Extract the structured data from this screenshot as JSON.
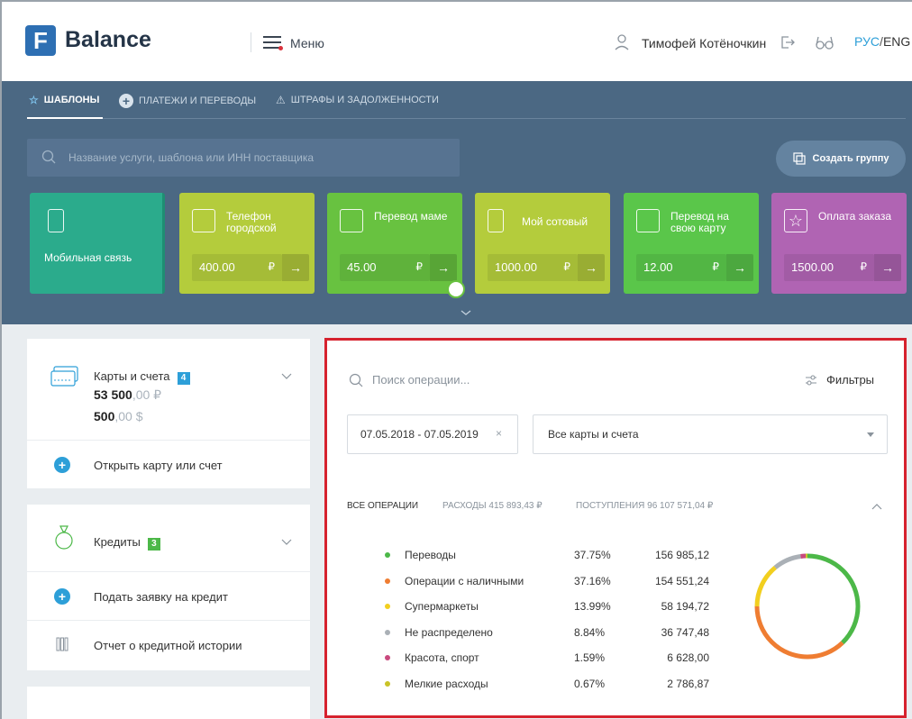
{
  "header": {
    "logo_letter": "F",
    "app_name": "Balance",
    "menu_label": "Меню",
    "user_name": "Тимофей Котёночкин",
    "lang_active": "РУС",
    "lang_sep": "/",
    "lang_other": "ENG"
  },
  "tabs": [
    {
      "label": "ШАБЛОНЫ",
      "active": true,
      "icon": "star-icon"
    },
    {
      "label": "ПЛАТЕЖИ И ПЕРЕВОДЫ",
      "active": false,
      "icon": "plus-circle-icon"
    },
    {
      "label": "ШТРАФЫ И ЗАДОЛЖЕННОСТИ",
      "active": false,
      "icon": "warning-icon"
    }
  ],
  "search": {
    "placeholder": "Название услуги, шаблона или ИНН поставщика"
  },
  "create_group_label": "Создать группу",
  "templates": [
    {
      "name": "Мобильная связь",
      "amount": "",
      "currency": "",
      "color": "#2bab8c",
      "icon": "phone-icon"
    },
    {
      "name": "Телефон городской",
      "amount": "400.00",
      "currency": "₽",
      "color": "#b4cc3c",
      "icon": "landline-icon"
    },
    {
      "name": "Перевод маме",
      "amount": "45.00",
      "currency": "₽",
      "color": "#68c240",
      "icon": "person-icon"
    },
    {
      "name": "Мой сотовый",
      "amount": "1000.00",
      "currency": "₽",
      "color": "#b4cc3c",
      "icon": "phone-icon"
    },
    {
      "name": "Перевод на свою карту",
      "amount": "12.00",
      "currency": "₽",
      "color": "#5ac64a",
      "icon": "person-transfer-icon"
    },
    {
      "name": "Оплата заказа",
      "amount": "1500.00",
      "currency": "₽",
      "color": "#b064b3",
      "icon": "star-icon"
    }
  ],
  "go_arrow": "→",
  "left_panel": {
    "accounts": {
      "title": "Карты и счета",
      "badge": "4",
      "badge_color": "#2d9fd8",
      "rub_whole": "53 500",
      "rub_frac": ",00 ₽",
      "usd_whole": "500",
      "usd_frac": ",00 $",
      "action": "Открыть карту или счет"
    },
    "credits": {
      "title": "Кредиты",
      "badge": "3",
      "badge_color": "#4cb848",
      "action": "Подать заявку на кредит",
      "report": "Отчет о кредитной истории"
    }
  },
  "operations": {
    "search_placeholder": "Поиск операции...",
    "filters_label": "Фильтры",
    "date_range": "07.05.2018 - 07.05.2019",
    "clear": "×",
    "cards_select": "Все карты и счета",
    "tabs": {
      "all": "ВСЕ ОПЕРАЦИИ",
      "expenses": "РАСХОДЫ 415 893,43 ₽",
      "income": "ПОСТУПЛЕНИЯ 96 107 571,04 ₽"
    },
    "categories": [
      {
        "name": "Переводы",
        "percent": "37.75%",
        "amount": "156 985,12",
        "color": "#4cb848"
      },
      {
        "name": "Операции с наличными",
        "percent": "37.16%",
        "amount": "154 551,24",
        "color": "#ef7d32"
      },
      {
        "name": "Супермаркеты",
        "percent": "13.99%",
        "amount": "58 194,72",
        "color": "#f2cf1f"
      },
      {
        "name": "Не распределено",
        "percent": "8.84%",
        "amount": "36 747,48",
        "color": "#aab0b6"
      },
      {
        "name": "Красота, спорт",
        "percent": "1.59%",
        "amount": "6 628,00",
        "color": "#c94a7e"
      },
      {
        "name": "Мелкие расходы",
        "percent": "0.67%",
        "amount": "2 786,87",
        "color": "#c9c326"
      }
    ]
  }
}
